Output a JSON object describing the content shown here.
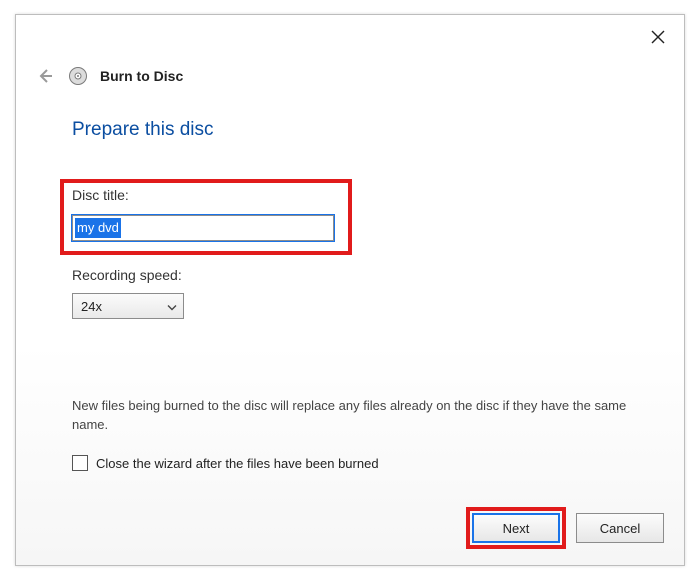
{
  "window": {
    "title": "Burn to Disc"
  },
  "heading": "Prepare this disc",
  "disc_title": {
    "label": "Disc title:",
    "value": "my dvd"
  },
  "recording_speed": {
    "label": "Recording speed:",
    "value": "24x"
  },
  "note": "New files being burned to the disc will replace any files already on the disc if they have the same name.",
  "checkbox": {
    "label": "Close the wizard after the files have been burned",
    "checked": false
  },
  "buttons": {
    "next": "Next",
    "cancel": "Cancel"
  }
}
